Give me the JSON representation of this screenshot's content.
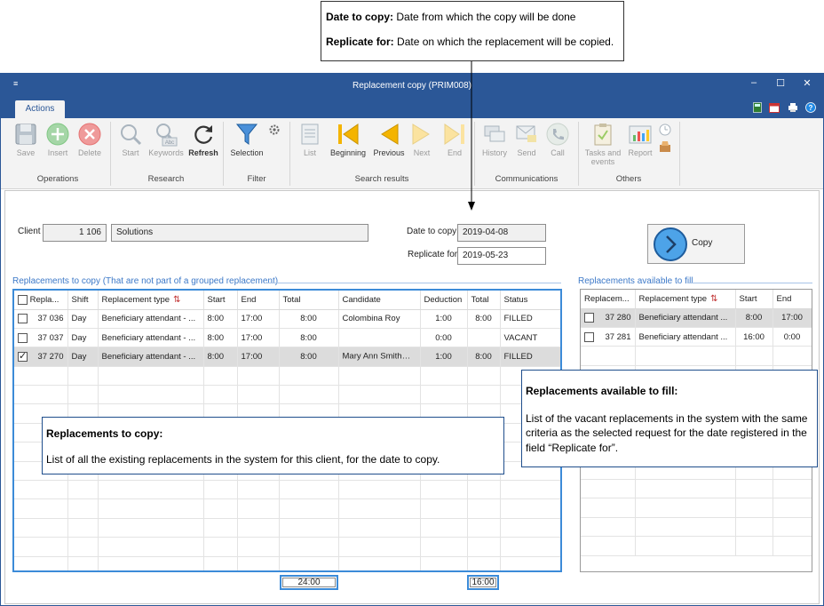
{
  "callouts": {
    "top": {
      "line1_bold": "Date to copy:",
      "line1_text": "Date from which the copy will be done",
      "line2_bold": "Replicate for:",
      "line2_text": "Date on which the replacement will be copied."
    },
    "left": {
      "title": "Replacements to copy:",
      "text": "List of all the existing replacements in the system for this client, for the date to copy."
    },
    "right": {
      "title": "Replacements available to fill:",
      "text": "List of the vacant replacements in the system with the same criteria as the selected request for the date registered in the field “Replicate for”."
    }
  },
  "window": {
    "title": "Replacement copy (PRIM008)",
    "tab": "Actions"
  },
  "ribbon": {
    "buttons": {
      "save": "Save",
      "insert": "Insert",
      "delete": "Delete",
      "start": "Start",
      "keywords": "Keywords",
      "refresh": "Refresh",
      "selection": "Selection",
      "list": "List",
      "beginning": "Beginning",
      "previous": "Previous",
      "next": "Next",
      "end": "End",
      "history": "History",
      "send": "Send",
      "call": "Call",
      "tasks_line1": "Tasks and",
      "tasks_line2": "events",
      "report": "Report"
    },
    "groups": {
      "operations": "Operations",
      "research": "Research",
      "filter": "Filter",
      "search_results": "Search results",
      "communications": "Communications",
      "others": "Others"
    }
  },
  "form": {
    "client_label": "Client",
    "client_number": "1 106",
    "client_name": "Solutions",
    "date_to_copy_label": "Date to copy",
    "date_to_copy": "2019-04-08",
    "replicate_for_label": "Replicate for",
    "replicate_for": "2019-05-23",
    "copy_button": "Copy"
  },
  "left_grid": {
    "title": "Replacements to copy (That are not part of a grouped replacement)",
    "columns": [
      "Repla...",
      "Shift",
      "Replacement type",
      "Start",
      "End",
      "Total",
      "Candidate",
      "Deduction",
      "Total",
      "Status"
    ],
    "rows": [
      {
        "checked": false,
        "id": "37 036",
        "shift": "Day",
        "type": "Beneficiary attendant - ...",
        "start": "8:00",
        "end": "17:00",
        "total": "8:00",
        "candidate": "Colombina Roy",
        "deduction": "1:00",
        "total2": "8:00",
        "status": "FILLED"
      },
      {
        "checked": false,
        "id": "37 037",
        "shift": "Day",
        "type": "Beneficiary attendant - ...",
        "start": "8:00",
        "end": "17:00",
        "total": "8:00",
        "candidate": "",
        "deduction": "0:00",
        "total2": "",
        "status": "VACANT"
      },
      {
        "checked": true,
        "id": "37 270",
        "shift": "Day",
        "type": "Beneficiary attendant - ...",
        "start": "8:00",
        "end": "17:00",
        "total": "8:00",
        "candidate": "Mary Ann Smith",
        "deduction": "1:00",
        "total2": "8:00",
        "status": "FILLED"
      }
    ],
    "footer_total1": "24:00",
    "footer_total2": "16:00"
  },
  "right_grid": {
    "title": "Replacements available to fill",
    "columns": [
      "Replacem...",
      "Replacement type",
      "Start",
      "End"
    ],
    "rows": [
      {
        "checked": false,
        "id": "37 280",
        "type": "Beneficiary attendant ...",
        "start": "8:00",
        "end": "17:00"
      },
      {
        "checked": false,
        "id": "37 281",
        "type": "Beneficiary attendant ...",
        "start": "16:00",
        "end": "0:00"
      }
    ]
  }
}
